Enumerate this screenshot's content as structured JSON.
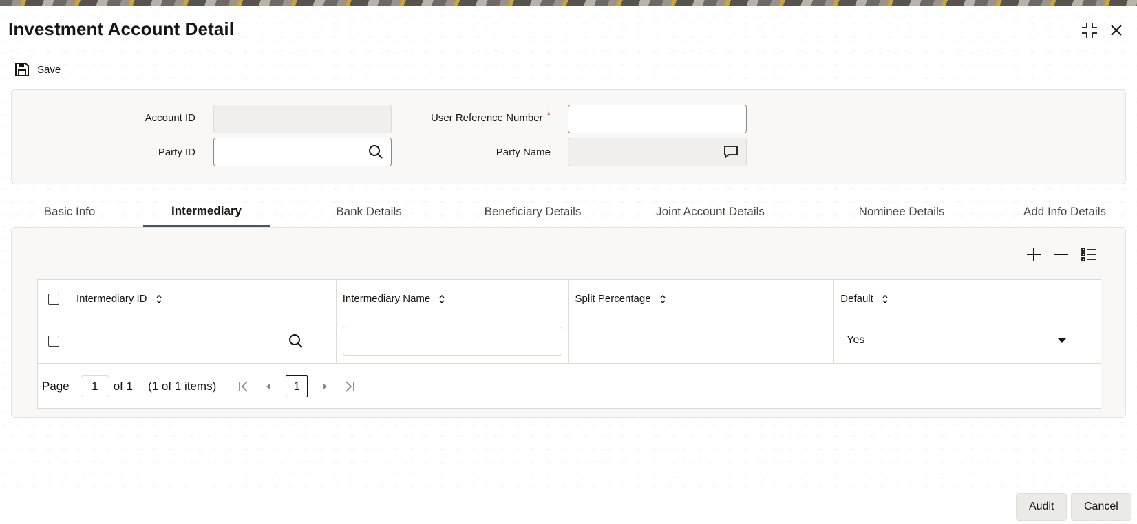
{
  "window": {
    "title": "Investment Account Detail"
  },
  "toolbar": {
    "save_label": "Save"
  },
  "form": {
    "account_id": {
      "label": "Account ID",
      "value": ""
    },
    "user_reference_number": {
      "label": "User Reference Number",
      "required_marker": "*",
      "value": ""
    },
    "party_id": {
      "label": "Party ID",
      "value": ""
    },
    "party_name": {
      "label": "Party Name",
      "value": ""
    }
  },
  "tabs": [
    {
      "label": "Basic Info",
      "active": false
    },
    {
      "label": "Intermediary",
      "active": true
    },
    {
      "label": "Bank Details",
      "active": false
    },
    {
      "label": "Beneficiary Details",
      "active": false
    },
    {
      "label": "Joint Account Details",
      "active": false
    },
    {
      "label": "Nominee Details",
      "active": false
    },
    {
      "label": "Add Info Details",
      "active": false
    }
  ],
  "grid": {
    "columns": [
      "Intermediary ID",
      "Intermediary Name",
      "Split Percentage",
      "Default"
    ],
    "rows": [
      {
        "intermediary_id": "",
        "intermediary_name": "",
        "split_percentage": "",
        "default": "Yes"
      }
    ]
  },
  "pager": {
    "page_label": "Page",
    "page_value": "1",
    "of_label": "of 1",
    "items_label": "(1 of 1 items)",
    "current_page": "1"
  },
  "footer": {
    "audit_label": "Audit",
    "cancel_label": "Cancel"
  },
  "icons": {
    "save": "save-icon",
    "search": "search-icon",
    "comment": "comment-icon",
    "add": "plus-icon",
    "remove": "minus-icon",
    "columns": "list-icon",
    "sort": "sort-icon",
    "minimize": "minimize-icon",
    "close": "close-icon"
  },
  "colors": {
    "active_tab_underline": "#4b5262",
    "required": "#c74634"
  }
}
